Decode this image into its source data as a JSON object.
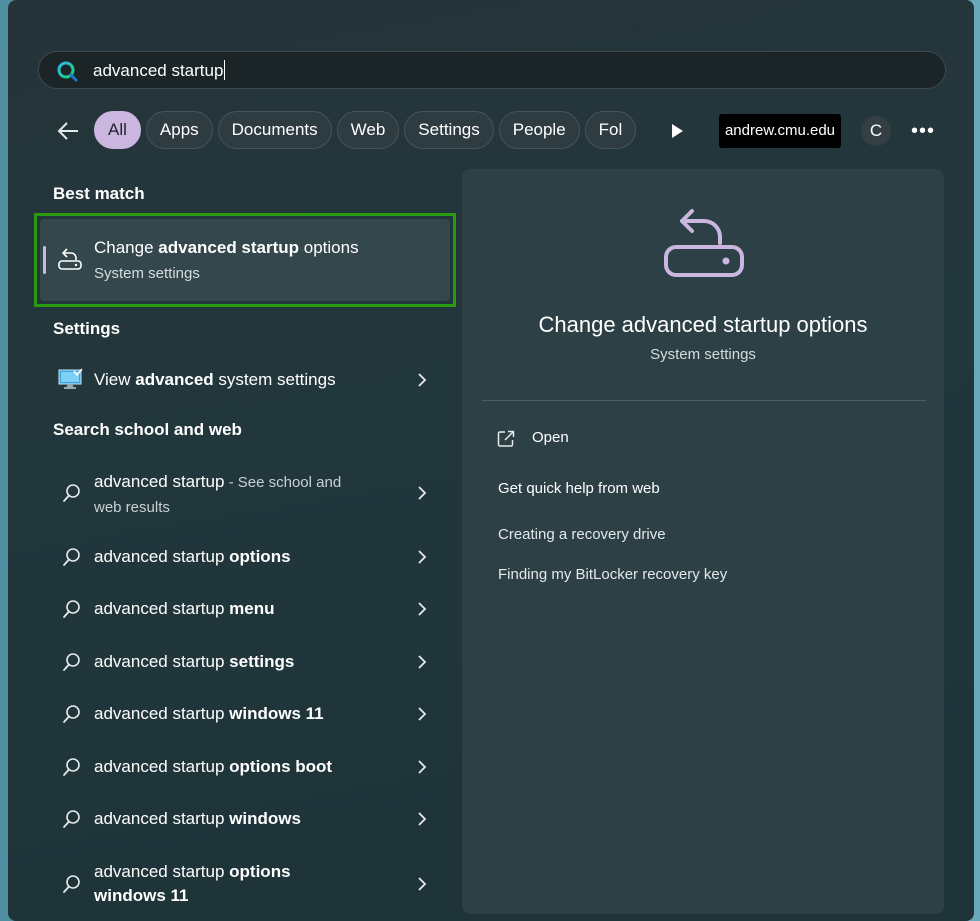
{
  "search": {
    "query": "advanced startup"
  },
  "filters": {
    "chips": [
      "All",
      "Apps",
      "Documents",
      "Web",
      "Settings",
      "People",
      "Fol"
    ],
    "active": "All",
    "account": "andrew.cmu.edu",
    "avatar_letter": "C",
    "more": "•••"
  },
  "best_match": {
    "heading": "Best match",
    "title_pre": "Change ",
    "title_bold": "advanced startup",
    "title_post": " options",
    "subtitle": "System settings"
  },
  "settings": {
    "heading": "Settings",
    "item_pre": "View ",
    "item_bold": "advanced",
    "item_post": " system settings"
  },
  "web": {
    "heading": "Search school and web",
    "first": {
      "text": "advanced startup",
      "suffix": " - See school and web results"
    },
    "items": [
      {
        "plain": "advanced startup ",
        "bold": "options"
      },
      {
        "plain": "advanced startup ",
        "bold": "menu"
      },
      {
        "plain": "advanced startup ",
        "bold": "settings"
      },
      {
        "plain": "advanced startup ",
        "bold": "windows 11"
      },
      {
        "plain": "advanced startup ",
        "bold": "options boot"
      },
      {
        "plain": "advanced startup ",
        "bold": "windows"
      },
      {
        "plain": "advanced startup ",
        "bold": "options windows 11"
      }
    ]
  },
  "detail": {
    "title": "Change advanced startup options",
    "subtitle": "System settings",
    "open_label": "Open",
    "help_heading": "Get quick help from web",
    "links": [
      "Creating a recovery drive",
      "Finding my BitLocker recovery key"
    ]
  },
  "colors": {
    "accent": "#cbb6e0",
    "highlight_outline": "#2a9b10",
    "panel": "#2d4045"
  }
}
